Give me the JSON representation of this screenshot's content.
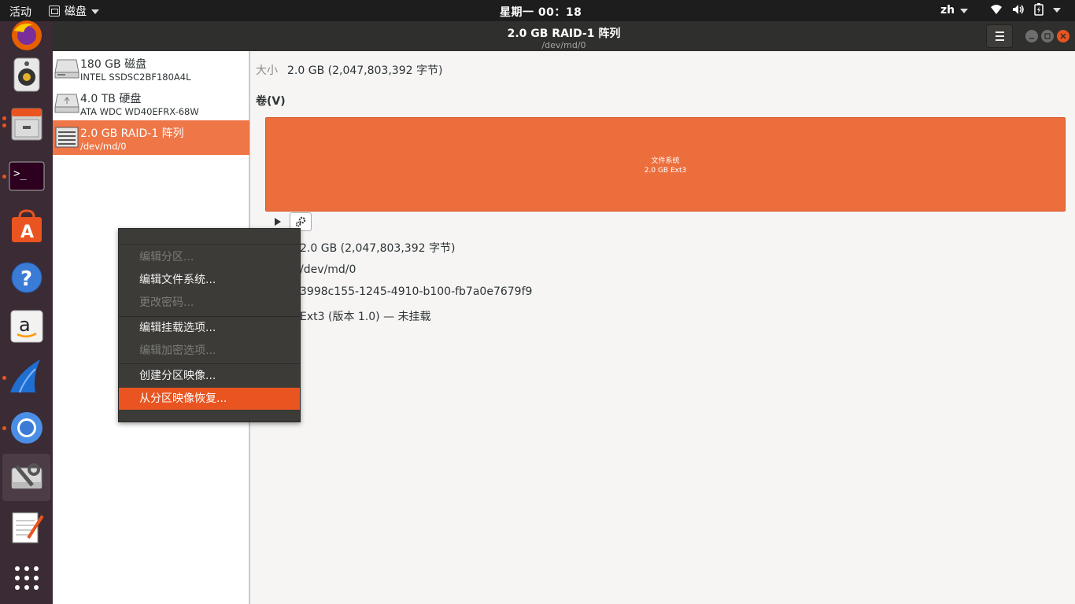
{
  "topbar": {
    "activities": "活动",
    "app_name": "磁盘",
    "clock": "星期一 00：18",
    "lang": "zh"
  },
  "dock": {
    "items": [
      {
        "name": "firefox"
      },
      {
        "name": "rhythmbox"
      },
      {
        "name": "files"
      },
      {
        "name": "terminal"
      },
      {
        "name": "software"
      },
      {
        "name": "help"
      },
      {
        "name": "amazon"
      },
      {
        "name": "wireshark"
      },
      {
        "name": "chromium"
      },
      {
        "name": "disks"
      },
      {
        "name": "text-editor"
      },
      {
        "name": "show-apps"
      }
    ]
  },
  "window": {
    "title": "2.0 GB RAID-1 阵列",
    "subtitle": "/dev/md/0"
  },
  "sidebar": {
    "disks": [
      {
        "name": "180 GB 磁盘",
        "model": "INTEL SSDSC2BF180A4L",
        "icon": "ssd-icon"
      },
      {
        "name": "4.0 TB 硬盘",
        "model": "ATA WDC WD40EFRX-68W",
        "icon": "hdd-icon"
      },
      {
        "name": "2.0 GB RAID-1 阵列",
        "model": "/dev/md/0",
        "icon": "raid-icon",
        "selected": true
      }
    ]
  },
  "main": {
    "size_label": "大小",
    "size_value": "2.0 GB (2,047,803,392 字节)",
    "volumes_heading": "卷(V)",
    "partition": {
      "line1": "文件系统",
      "line2": "2.0 GB Ext3"
    },
    "details": [
      "2.0 GB (2,047,803,392 字节)",
      "/dev/md/0",
      "3998c155-1245-4910-b100-fb7a0e7679f9",
      "Ext3 (版本 1.0) — 未挂载"
    ]
  },
  "context_menu": {
    "items": [
      {
        "label": "编辑分区...",
        "enabled": false
      },
      {
        "label": "编辑文件系统...",
        "enabled": true
      },
      {
        "label": "更改密码...",
        "enabled": false
      },
      {
        "label": "编辑挂载选项...",
        "enabled": true
      },
      {
        "label": "编辑加密选项...",
        "enabled": false
      },
      {
        "label": "创建分区映像...",
        "enabled": true
      },
      {
        "label": "从分区映像恢复...",
        "enabled": true,
        "highlighted": true
      }
    ]
  },
  "colors": {
    "accent": "#e95420",
    "partition": "#ec6e3d",
    "selected_row": "#ef7647",
    "dock_bg": "#3b2b35",
    "topbar_bg": "#1d1d1d"
  }
}
